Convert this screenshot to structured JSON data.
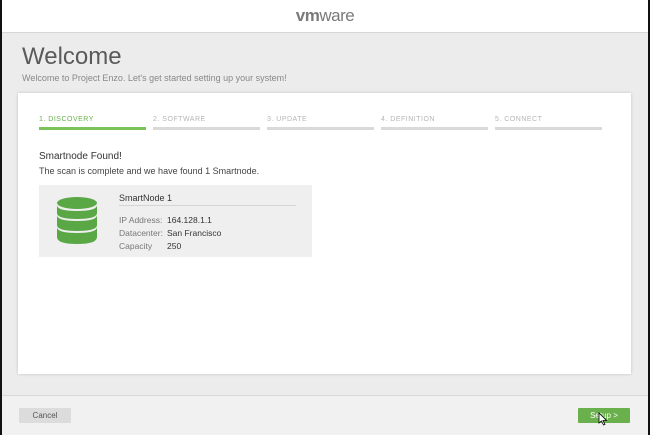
{
  "header": {
    "brand_vm": "vm",
    "brand_ware": "ware"
  },
  "page": {
    "title": "Welcome",
    "subtitle": "Welcome to Project Enzo. Let's get started setting up your system!"
  },
  "steps": [
    {
      "label": "1. DISCOVERY",
      "active": true
    },
    {
      "label": "2. SOFTWARE",
      "active": false
    },
    {
      "label": "3. UPDATE",
      "active": false
    },
    {
      "label": "4. DEFINITION",
      "active": false
    },
    {
      "label": "5. CONNECT",
      "active": false
    }
  ],
  "discovery": {
    "title": "Smartnode Found!",
    "description": "The scan is complete and we have found 1 Smartnode.",
    "node": {
      "name": "SmartNode 1",
      "icon": "database-icon",
      "properties": [
        {
          "key": "IP Address:",
          "value": "164.128.1.1"
        },
        {
          "key": "Datacenter:",
          "value": "San Francisco"
        },
        {
          "key": "Capacity",
          "value": "250"
        }
      ]
    }
  },
  "footer": {
    "cancel_label": "Cancel",
    "setup_label": "Setup >"
  },
  "colors": {
    "accent": "#6ab04c",
    "icon": "#5aa845"
  }
}
